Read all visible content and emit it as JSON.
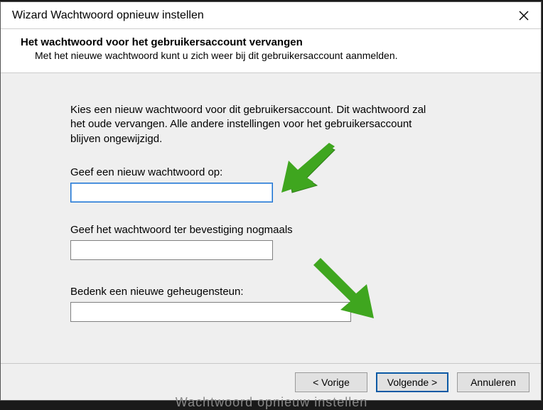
{
  "title": "Wizard Wachtwoord opnieuw instellen",
  "header": {
    "title": "Het wachtwoord voor het gebruikersaccount vervangen",
    "sub": "Met het nieuwe wachtwoord kunt u zich weer bij dit gebruikersaccount aanmelden."
  },
  "body": {
    "intro": "Kies een nieuw wachtwoord voor dit gebruikersaccount. Dit wachtwoord zal het oude vervangen. Alle andere instellingen voor het gebruikersaccount blijven ongewijzigd.",
    "label_new": "Geef een nieuw wachtwoord op:",
    "label_confirm": "Geef het wachtwoord ter bevestiging nogmaals",
    "label_hint": "Bedenk een nieuwe geheugensteun:",
    "value_new": "",
    "value_confirm": "",
    "value_hint": ""
  },
  "buttons": {
    "back": "< Vorige",
    "next": "Volgende >",
    "cancel": "Annuleren"
  },
  "bg_text": "Wachtwoord opnieuw instellen"
}
